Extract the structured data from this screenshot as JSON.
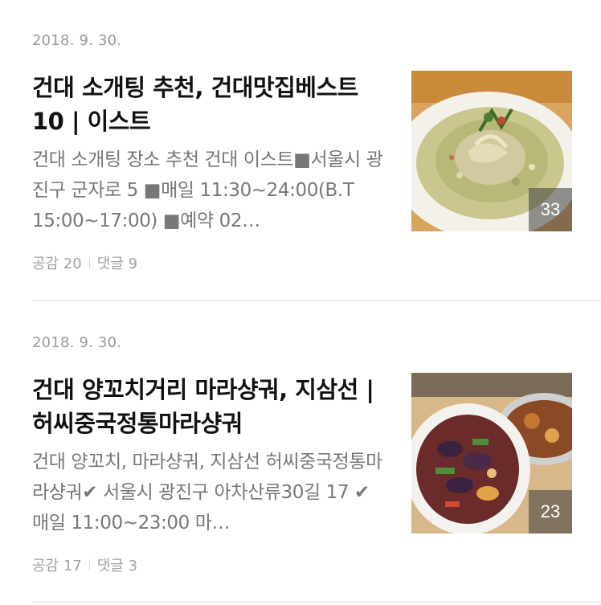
{
  "posts": [
    {
      "date": "2018. 9. 30.",
      "title": "건대 소개팅 추천, 건대맛집베스트10 | 이스트",
      "summary": "건대 소개팅 장소 추천 건대 이스트■서울시 광진구 군자로 5 ■매일 11:30~24:00(B.T 15:00~17:00) ■예약 02…",
      "likes": "공감 20",
      "comments": "댓글 9",
      "photo_count": "33",
      "thumb_subject": "green-curry-pasta"
    },
    {
      "date": "2018. 9. 30.",
      "title": "건대 양꼬치거리 마라샹궈, 지삼선 | 허씨중국정통마라샹궈",
      "summary": "건대 양꼬치, 마라샹궈, 지삼선 허씨중국정통마라샹궈✔ 서울시 광진구 아차산류30길 17 ✔매일 11:00~23:00 마…",
      "likes": "공감 17",
      "comments": "댓글 3",
      "photo_count": "23",
      "thumb_subject": "eggplant-stir-fry"
    }
  ]
}
